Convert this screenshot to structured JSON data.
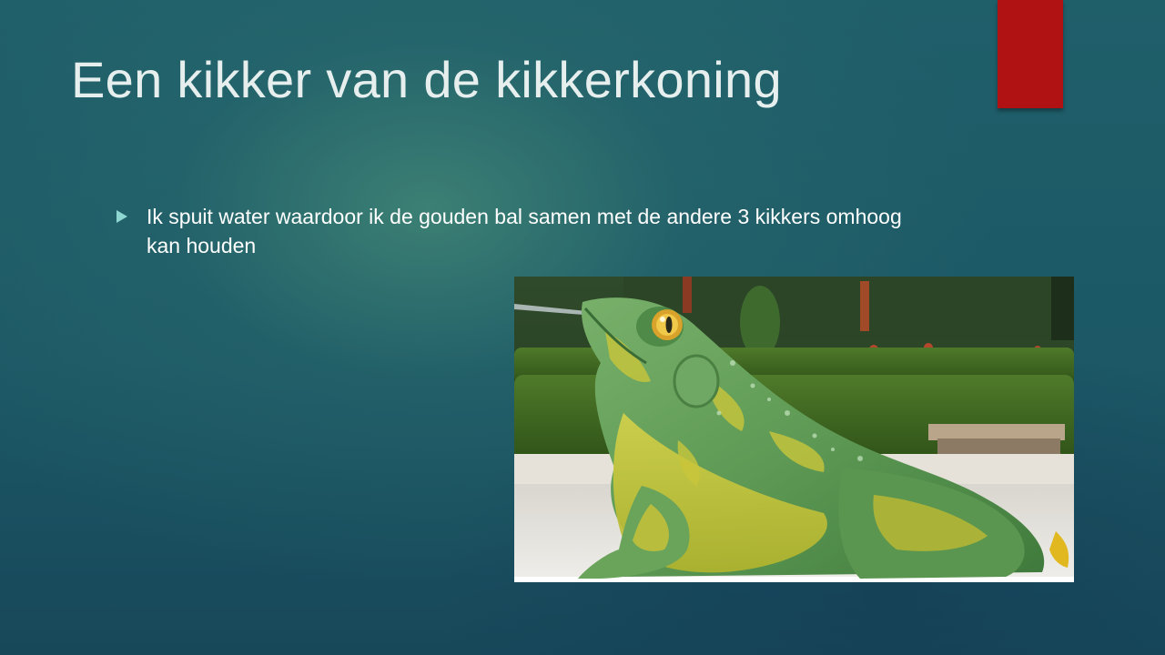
{
  "slide": {
    "title": "Een kikker van de kikkerkoning",
    "bullets": [
      {
        "text": "Ik spuit water waardoor ik de gouden bal samen met de andere 3 kikkers omhoog kan houden"
      }
    ]
  },
  "colors": {
    "accent_bar": "#b01214",
    "bullet_marker": "#8ed6d2",
    "title_text": "#e6efee",
    "body_text": "#ffffff"
  },
  "photo": {
    "subject": "frog-statue-photo"
  }
}
